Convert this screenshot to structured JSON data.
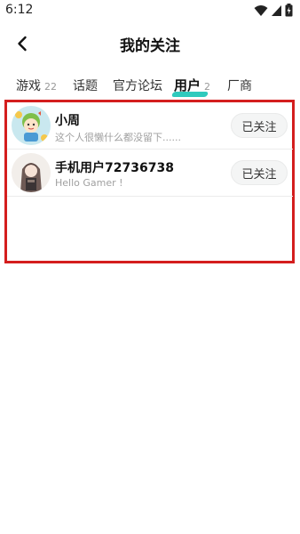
{
  "status_bar": {
    "time": "6:12",
    "icons": [
      "wifi-icon",
      "signal-icon",
      "battery-charging-icon"
    ]
  },
  "header": {
    "title": "我的关注",
    "back_icon": "chevron-left-icon"
  },
  "tabs": [
    {
      "label": "游戏",
      "count": "22",
      "active": false
    },
    {
      "label": "话题",
      "count": "",
      "active": false
    },
    {
      "label": "官方论坛",
      "count": "",
      "active": false
    },
    {
      "label": "用户",
      "count": "2",
      "active": true
    },
    {
      "label": "厂商",
      "count": "",
      "active": false
    }
  ],
  "users": [
    {
      "name": "小周",
      "bio": "这个人很懒什么都没留下......",
      "follow_label": "已关注"
    },
    {
      "name": "手机用户72736738",
      "bio": "Hello Gamer !",
      "follow_label": "已关注"
    }
  ],
  "colors": {
    "accent": "#18c4b6",
    "highlight_border": "#d41e1e"
  }
}
